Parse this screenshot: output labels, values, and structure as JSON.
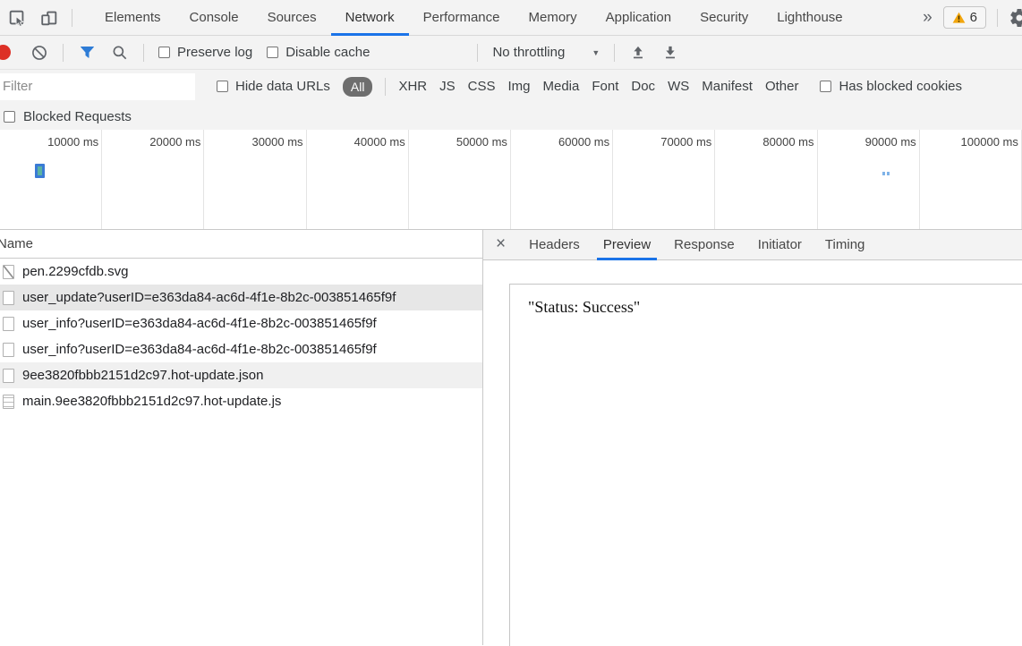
{
  "colors": {
    "accent_blue": "#1a73e8",
    "record_red": "#dd3026",
    "filter_funnel_blue": "#2e7cd6",
    "warning_orange": "#f2a60d",
    "chrome_bar_gray": "#f3f3f3",
    "timeline_bar_blue": "#3a7bd5",
    "timeline_bar_teal": "#5cb3a2"
  },
  "icons": {
    "overflow_chevrons": "»",
    "dropdown_arrow": "▼",
    "close": "×",
    "settings_gear": "⚙"
  },
  "top_bar": {
    "tabs": [
      "Elements",
      "Console",
      "Sources",
      "Network",
      "Performance",
      "Memory",
      "Application",
      "Security",
      "Lighthouse"
    ],
    "active_tab": "Network",
    "warning_count": "6"
  },
  "toolbar": {
    "preserve_log_label": "Preserve log",
    "disable_cache_label": "Disable cache",
    "throttling_value": "No throttling"
  },
  "filter_bar": {
    "input_placeholder": "Filter",
    "input_value": "",
    "hide_data_urls_label": "Hide data URLs",
    "all_pill": "All",
    "types": [
      "XHR",
      "JS",
      "CSS",
      "Img",
      "Media",
      "Font",
      "Doc",
      "WS",
      "Manifest",
      "Other"
    ],
    "has_blocked_cookies_label": "Has blocked cookies"
  },
  "blocked_requests_label": "Blocked Requests",
  "timeline": {
    "ticks": [
      "10000 ms",
      "20000 ms",
      "30000 ms",
      "40000 ms",
      "50000 ms",
      "60000 ms",
      "70000 ms",
      "80000 ms",
      "90000 ms",
      "100000 ms"
    ],
    "markers": [
      {
        "type": "request-bar",
        "approx_time_ms": 3400
      },
      {
        "type": "request-dots",
        "approx_time_ms": 86300
      }
    ]
  },
  "requests": {
    "header": "Name",
    "rows": [
      {
        "name": "pen.2299cfdb.svg",
        "icon": "image-file"
      },
      {
        "name": "user_update?userID=e363da84-ac6d-4f1e-8b2c-003851465f9f",
        "icon": "file",
        "selected": true
      },
      {
        "name": "user_info?userID=e363da84-ac6d-4f1e-8b2c-003851465f9f",
        "icon": "file"
      },
      {
        "name": "user_info?userID=e363da84-ac6d-4f1e-8b2c-003851465f9f",
        "icon": "file"
      },
      {
        "name": "9ee3820fbbb2151d2c97.hot-update.json",
        "icon": "file"
      },
      {
        "name": "main.9ee3820fbbb2151d2c97.hot-update.js",
        "icon": "script-file"
      }
    ]
  },
  "details": {
    "tabs": [
      "Headers",
      "Preview",
      "Response",
      "Initiator",
      "Timing"
    ],
    "active_tab": "Preview",
    "preview_text": "\"Status: Success\""
  }
}
